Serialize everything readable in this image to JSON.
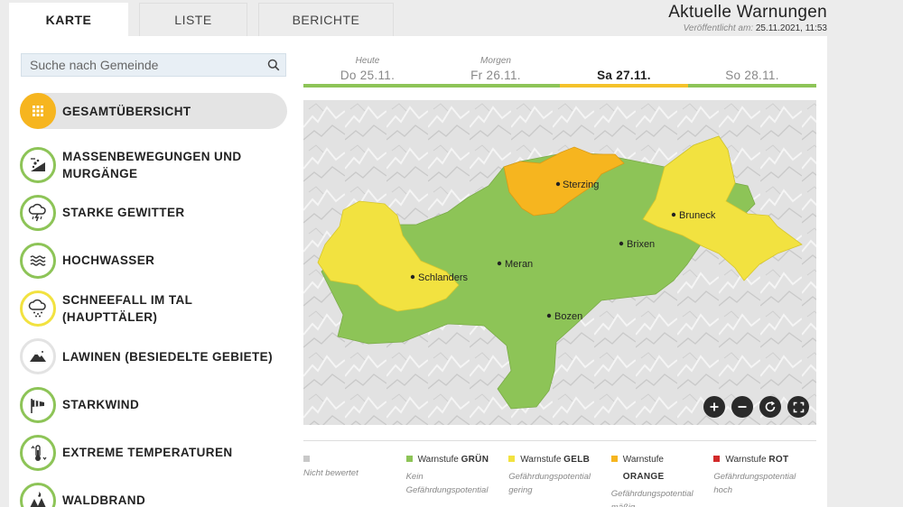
{
  "tabs": [
    {
      "label": "KARTE",
      "active": true
    },
    {
      "label": "LISTE",
      "active": false
    },
    {
      "label": "BERICHTE",
      "active": false
    }
  ],
  "header": {
    "title": "Aktuelle Warnungen",
    "published_label": "Veröffentlicht am:",
    "published_value": "25.11.2021, 11:53"
  },
  "search": {
    "placeholder": "Suche nach Gemeinde",
    "icon": "search-icon"
  },
  "categories": [
    {
      "label": "GESAMTÜBERSICHT",
      "icon": "grid-icon",
      "level": "orange",
      "active": true
    },
    {
      "label": "MASSENBEWEGUNGEN UND MURGÄNGE",
      "icon": "landslide-icon",
      "level": "green"
    },
    {
      "label": "STARKE GEWITTER",
      "icon": "thunderstorm-icon",
      "level": "green"
    },
    {
      "label": "HOCHWASSER",
      "icon": "flood-icon",
      "level": "green"
    },
    {
      "label": "SCHNEEFALL IM TAL (HAUPTTÄLER)",
      "icon": "snowfall-icon",
      "level": "yellow"
    },
    {
      "label": "LAWINEN (BESIEDELTE GEBIETE)",
      "icon": "avalanche-icon",
      "level": "none"
    },
    {
      "label": "STARKWIND",
      "icon": "windsock-icon",
      "level": "green"
    },
    {
      "label": "EXTREME TEMPERATUREN",
      "icon": "thermometer-icon",
      "level": "green"
    },
    {
      "label": "WALDBRAND",
      "icon": "forest-fire-icon",
      "level": "green"
    }
  ],
  "days": [
    {
      "sub": "Heute",
      "date": "Do 25.11.",
      "selected": false
    },
    {
      "sub": "Morgen",
      "date": "Fr 26.11.",
      "selected": false
    },
    {
      "sub": "",
      "date": "Sa 27.11.",
      "selected": true
    },
    {
      "sub": "",
      "date": "So 28.11.",
      "selected": false
    }
  ],
  "map": {
    "places": [
      "Sterzing",
      "Bruneck",
      "Brixen",
      "Meran",
      "Schlanders",
      "Bozen"
    ],
    "controls": [
      "zoom-in-icon",
      "zoom-out-icon",
      "reset-icon",
      "fullscreen-icon"
    ]
  },
  "colors": {
    "green": "#8dc457",
    "yellow": "#f2e240",
    "orange": "#f6b51f",
    "red": "#d22a2a",
    "grey": "#c8c8c8"
  },
  "legend": [
    {
      "prefix": "",
      "bold": "",
      "desc": "Nicht bewertet",
      "color": "#c8c8c8"
    },
    {
      "prefix": "Warnstufe ",
      "bold": "GRÜN",
      "desc": "Kein Gefährdungspotential",
      "color": "#8dc457"
    },
    {
      "prefix": "Warnstufe ",
      "bold": "GELB",
      "desc": "Gefährdungspotential gering",
      "color": "#f2e240"
    },
    {
      "prefix": "Warnstufe",
      "bold": "ORANGE",
      "desc": "Gefährdungspotential mäßig",
      "color": "#f6b51f"
    },
    {
      "prefix": "Warnstufe ",
      "bold": "ROT",
      "desc": "Gefährdungspotential hoch",
      "color": "#d22a2a"
    }
  ]
}
